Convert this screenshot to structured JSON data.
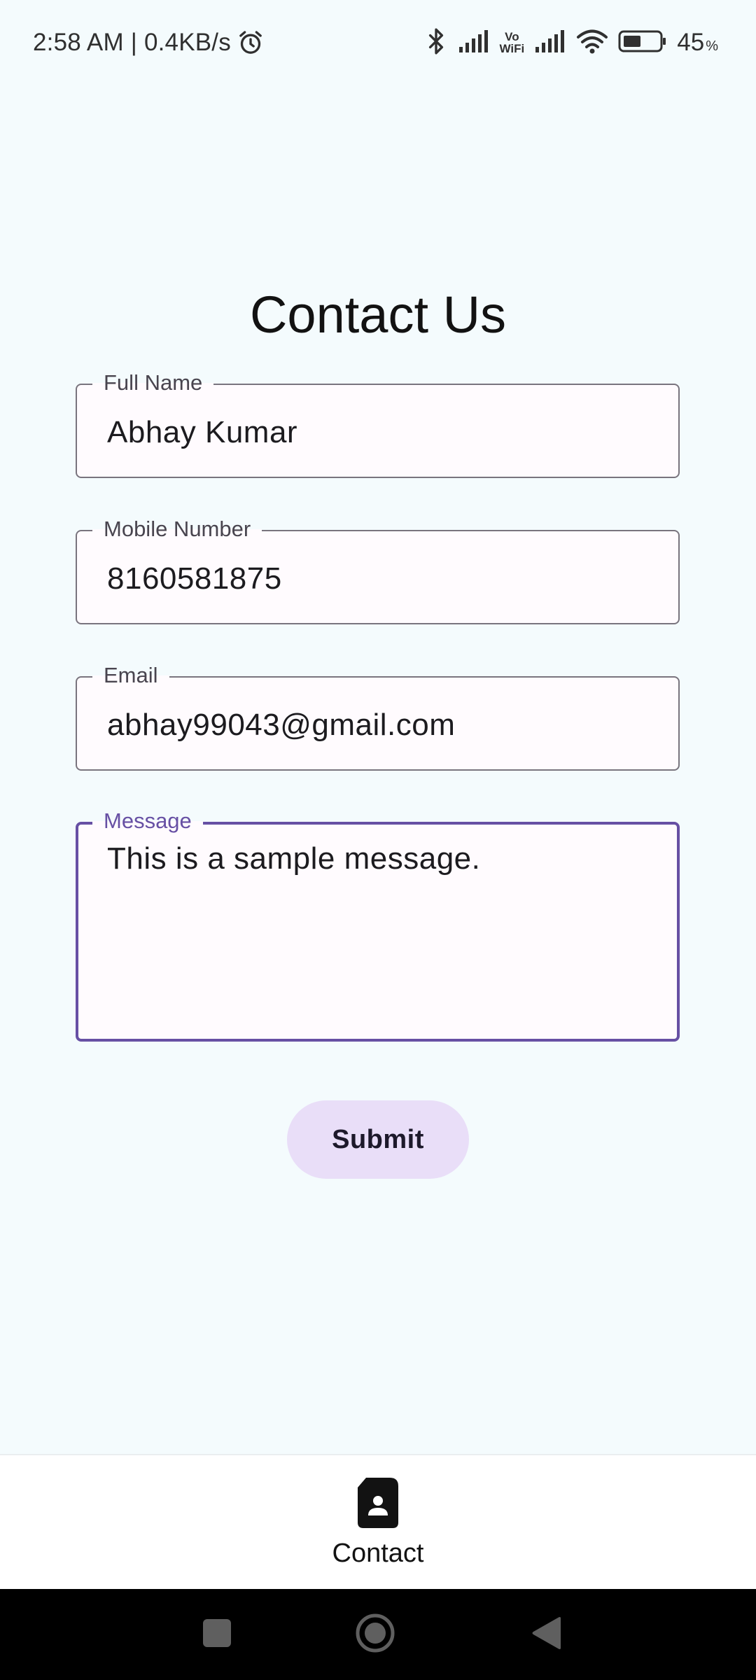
{
  "status_bar": {
    "time_speed": "2:58 AM | 0.4KB/s",
    "vowifi_top": "Vo",
    "vowifi_bottom": "WiFi",
    "battery": "45",
    "battery_unit": "%"
  },
  "page": {
    "title": "Contact Us"
  },
  "form": {
    "full_name": {
      "label": "Full Name",
      "value": "Abhay Kumar"
    },
    "mobile": {
      "label": "Mobile Number",
      "value": "8160581875"
    },
    "email": {
      "label": "Email",
      "value": "abhay99043@gmail.com"
    },
    "message": {
      "label": "Message",
      "value": "This is a sample message."
    },
    "submit_label": "Submit"
  },
  "bottom_nav": {
    "items": [
      {
        "label": "Contact",
        "icon": "contact-document-icon",
        "selected": true
      }
    ]
  },
  "colors": {
    "background": "#f4fbfd",
    "accent": "#6750a4",
    "button_bg": "#e9def8",
    "field_bg": "#fffbfe",
    "outline": "#79747e"
  }
}
